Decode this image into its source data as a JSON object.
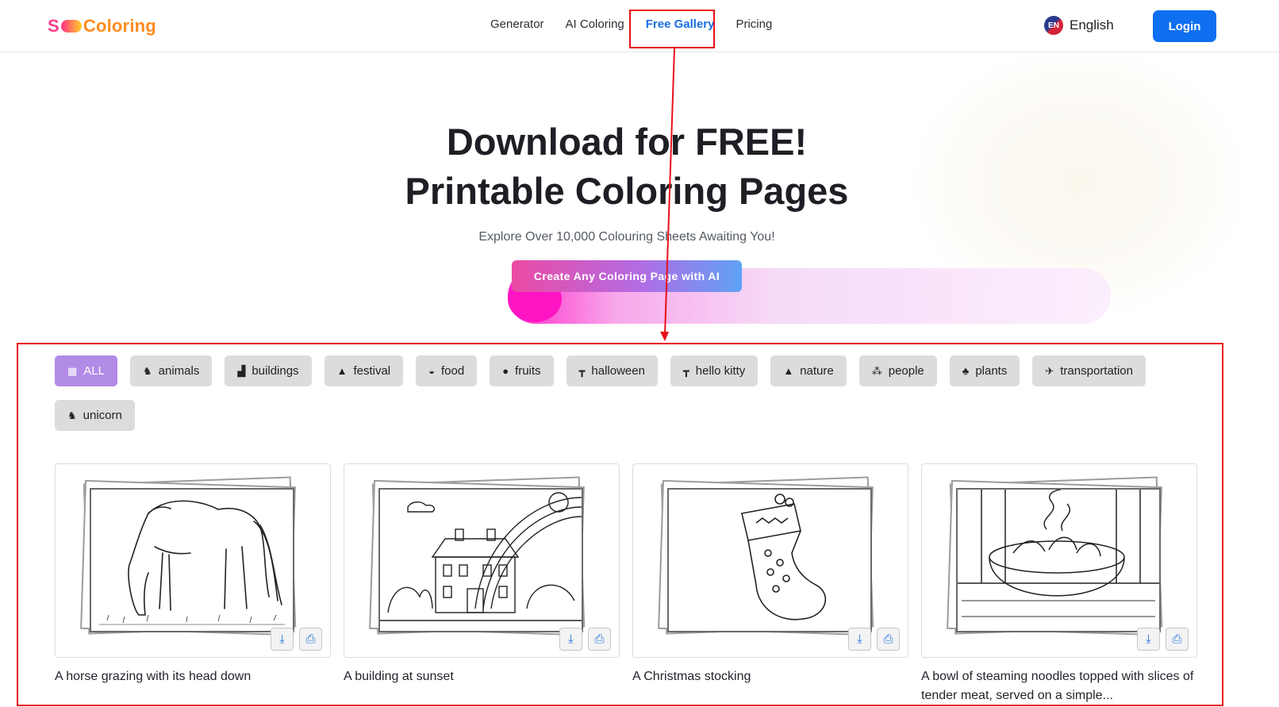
{
  "header": {
    "logo_text": [
      "S",
      "Coloring"
    ],
    "nav": [
      {
        "label": "Generator",
        "active": false
      },
      {
        "label": "AI Coloring",
        "active": false
      },
      {
        "label": "Free Gallery",
        "active": true
      },
      {
        "label": "Pricing",
        "active": false
      }
    ],
    "language": {
      "code": "EN",
      "label": "English"
    },
    "login_label": "Login"
  },
  "hero": {
    "title_line1": "Download for FREE!",
    "title_line2": "Printable Coloring Pages",
    "subtitle": "Explore Over 10,000 Colouring Sheets Awaiting You!",
    "cta_label": "Create Any Coloring Page with AI"
  },
  "categories": [
    {
      "label": "ALL",
      "icon": "grid-icon",
      "glyph": "▦",
      "active": true
    },
    {
      "label": "animals",
      "icon": "horse-icon",
      "glyph": "♞",
      "active": false
    },
    {
      "label": "buildings",
      "icon": "building-icon",
      "glyph": "▟",
      "active": false
    },
    {
      "label": "festival",
      "icon": "tree-icon",
      "glyph": "▲",
      "active": false
    },
    {
      "label": "food",
      "icon": "bowl-icon",
      "glyph": "◒",
      "active": false
    },
    {
      "label": "fruits",
      "icon": "apple-icon",
      "glyph": "●",
      "active": false
    },
    {
      "label": "halloween",
      "icon": "hammer-icon",
      "glyph": "┳",
      "active": false
    },
    {
      "label": "hello kitty",
      "icon": "hammer-icon",
      "glyph": "┳",
      "active": false
    },
    {
      "label": "nature",
      "icon": "mountain-icon",
      "glyph": "▲",
      "active": false
    },
    {
      "label": "people",
      "icon": "people-icon",
      "glyph": "⁂",
      "active": false
    },
    {
      "label": "plants",
      "icon": "plant-icon",
      "glyph": "♣",
      "active": false
    },
    {
      "label": "transportation",
      "icon": "plane-icon",
      "glyph": "✈",
      "active": false
    },
    {
      "label": "unicorn",
      "icon": "unicorn-icon",
      "glyph": "♞",
      "active": false
    }
  ],
  "gallery": [
    {
      "caption": "A horse grazing with its head down",
      "art": "horse"
    },
    {
      "caption": "A building at sunset",
      "art": "building"
    },
    {
      "caption": "A Christmas stocking",
      "art": "stocking"
    },
    {
      "caption": "A bowl of steaming noodles topped with slices of tender meat, served on a simple...",
      "art": "noodles"
    }
  ],
  "card_actions": {
    "download_icon": "download-icon",
    "print_icon": "printer-icon"
  },
  "accent_colors": {
    "primary": "#0e6ff0",
    "active_category": "#b28be6",
    "highlight": "#e8101c"
  }
}
